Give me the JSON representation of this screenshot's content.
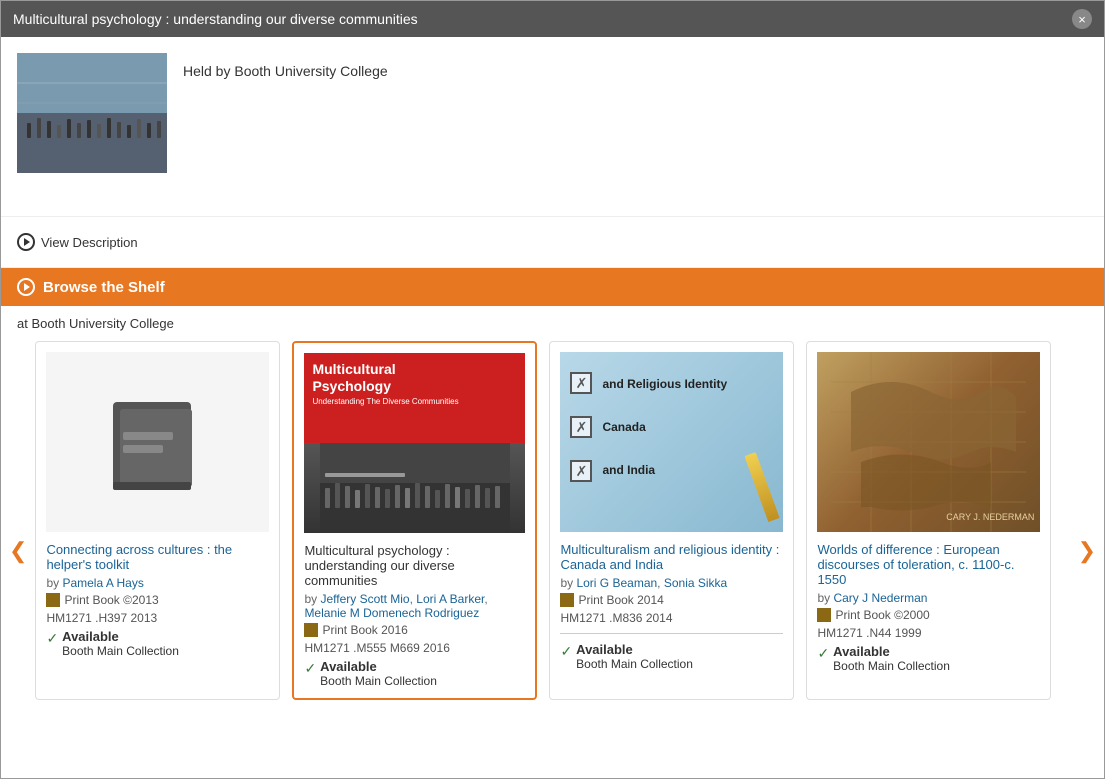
{
  "modal": {
    "title": "Multicultural psychology : understanding our diverse communities",
    "close_label": "×"
  },
  "header": {
    "held_by": "Held by Booth University College",
    "view_description_label": "View Description"
  },
  "browse_shelf": {
    "label": "Browse the Shelf",
    "location": "at Booth University College"
  },
  "scroll_left": "❮",
  "scroll_right": "❯",
  "books": [
    {
      "id": "book1",
      "title": "Connecting across cultures : the helper's toolkit",
      "title_is_link": true,
      "authors": [
        {
          "name": "Pamela A Hays",
          "is_link": true
        }
      ],
      "authors_prefix": "by",
      "format": "Print Book ©2013",
      "call_number": "HM1271 .H397 2013",
      "available": true,
      "available_label": "Available",
      "collection": "Booth Main Collection",
      "active": false,
      "has_cover_image": false
    },
    {
      "id": "book2",
      "title": "Multicultural psychology : understanding our diverse communities",
      "title_is_link": false,
      "authors": [
        {
          "name": "Jeffery Scott Mio",
          "is_link": true
        },
        {
          "name": "Lori A Barker",
          "is_link": true
        },
        {
          "name": "Melanie M Domenech Rodriguez",
          "is_link": true
        }
      ],
      "authors_prefix": "by",
      "format": "Print Book 2016",
      "call_number": "HM1271 .M555 M669 2016",
      "available": true,
      "available_label": "Available",
      "collection": "Booth Main Collection",
      "active": true,
      "has_cover_image": true,
      "cover_type": "multicultural"
    },
    {
      "id": "book3",
      "title": "Multiculturalism and religious identity : Canada and India",
      "title_is_link": true,
      "authors": [
        {
          "name": "Lori G Beaman",
          "is_link": true
        },
        {
          "name": "Sonia Sikka",
          "is_link": true
        }
      ],
      "authors_prefix": "by",
      "format": "Print Book 2014",
      "call_number": "HM1271 .M836 2014",
      "available": true,
      "available_label": "Available",
      "collection": "Booth Main Collection",
      "active": false,
      "has_cover_image": true,
      "cover_type": "religious"
    },
    {
      "id": "book4",
      "title": "Worlds of difference : European discourses of toleration, c. 1100-c. 1550",
      "title_is_link": true,
      "authors": [
        {
          "name": "Cary J Nederman",
          "is_link": true
        }
      ],
      "authors_prefix": "by",
      "format": "Print Book ©2000",
      "call_number": "HM1271 .N44 1999",
      "available": true,
      "available_label": "Available",
      "collection": "Booth Main Collection",
      "active": false,
      "has_cover_image": true,
      "cover_type": "worlds"
    }
  ]
}
